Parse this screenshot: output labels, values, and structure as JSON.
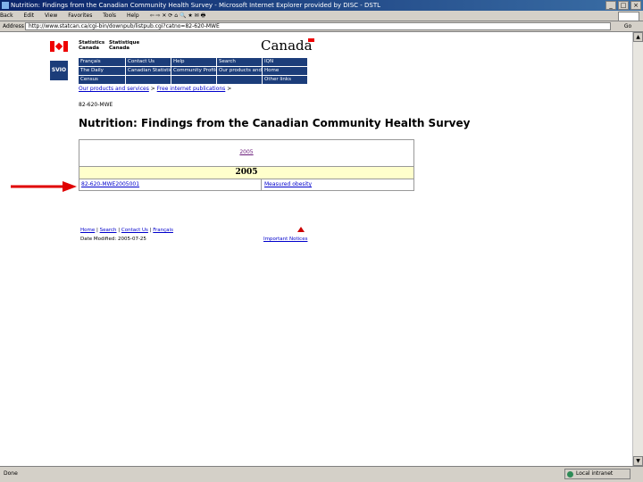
{
  "window": {
    "title": "Nutrition: Findings from the Canadian Community Health Survey - Microsoft Internet Explorer provided by DISC - DSTL"
  },
  "toolbar": {
    "back": "Back",
    "file": "Edit",
    "view": "View",
    "favorites": "Favorites",
    "tools": "Tools",
    "help": "Help"
  },
  "address": {
    "label": "Address",
    "url": "http://www.statcan.ca/cgi-bin/downpub/listpub.cgi?catno=82-620-MWE",
    "go": "Go"
  },
  "header": {
    "statcan_en_1": "Statistics",
    "statcan_en_2": "Canada",
    "statcan_fr_1": "Statistique",
    "statcan_fr_2": "Canada",
    "canada_wordmark": "Canada",
    "logo": "SVIO"
  },
  "nav": {
    "items": [
      "Français",
      "Contact Us",
      "Help",
      "Search",
      "IQN",
      "The Daily",
      "Canadian Statistics",
      "Community Profiles",
      "Our products and services",
      "Home",
      "Census",
      "",
      "",
      "",
      "Other links"
    ]
  },
  "breadcrumb": {
    "link1": "Our products and services",
    "sep": " > ",
    "link2": "Free internet publications",
    "tail": " >"
  },
  "catalogue_no": "82-620-MWE",
  "page_title": "Nutrition: Findings from the Canadian Community Health Survey",
  "table": {
    "year_link": "2005",
    "year_header": "2005",
    "rows": [
      {
        "id": "82-620-MWE2005001",
        "title": "Measured obesity"
      }
    ]
  },
  "footer": {
    "links": [
      "Home",
      "Search",
      "Contact Us",
      "Français"
    ],
    "modified": "Date Modified: 2005-07-25",
    "important_notices": "Important Notices"
  },
  "statusbar": {
    "left": "Done",
    "zone": "Local intranet"
  },
  "colors": {
    "nav_bg": "#1c3d7a",
    "year_header_bg": "#ffffcc",
    "arrow": "#e00000"
  }
}
